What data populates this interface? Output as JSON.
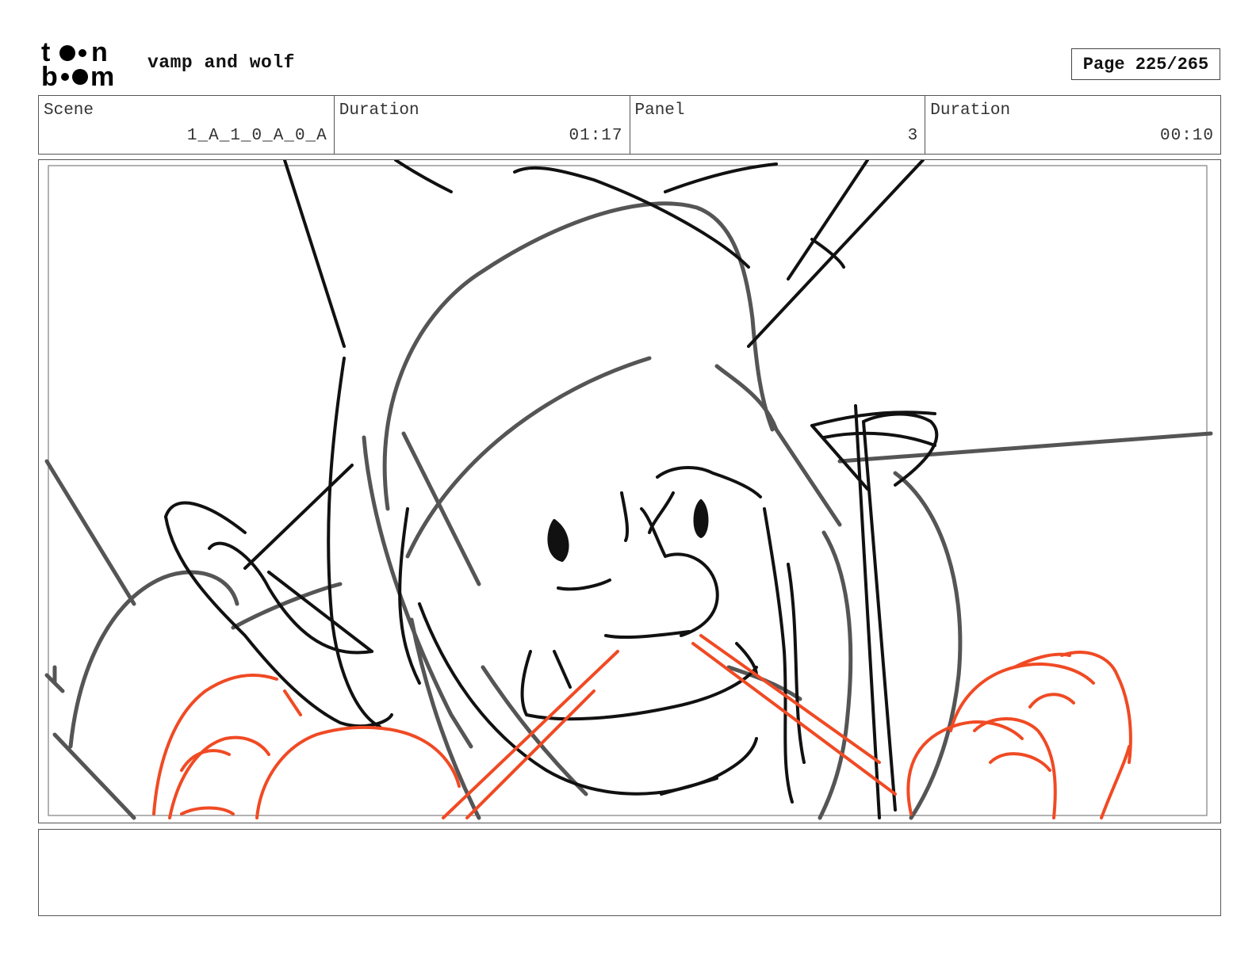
{
  "header": {
    "project_title": "vamp and wolf",
    "page_label": "Page 225/265"
  },
  "logo": {
    "icon": "toon-boom-logo",
    "line1": "toon",
    "line2": "boom"
  },
  "info": {
    "scene_label": "Scene",
    "scene_value": "1_A_1_0_A_0_A",
    "scene_duration_label": "Duration",
    "scene_duration_value": "01:17",
    "panel_label": "Panel",
    "panel_value": "3",
    "panel_duration_label": "Duration",
    "panel_duration_value": "00:10"
  },
  "panel": {
    "image": "storyboard-sketch",
    "colors": {
      "ink": "#111111",
      "gray": "#555555",
      "red": "#f04a24"
    }
  },
  "notes": {
    "text": ""
  }
}
